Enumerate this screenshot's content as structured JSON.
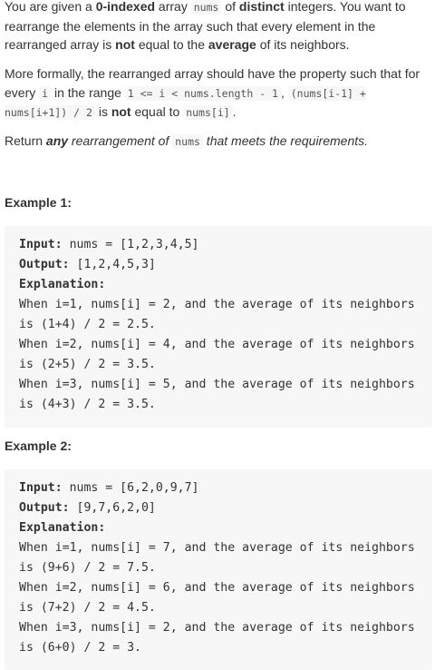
{
  "description": {
    "para1": {
      "t1": "You are given a ",
      "b1": "0-indexed",
      "t2": " array ",
      "c1": "nums",
      "t3": " of ",
      "b2": "distinct",
      "t4": " integers. You want to rearrange the elements in the array such that every element in the rearranged array is ",
      "b3": "not",
      "t5": " equal to the ",
      "b4": "average",
      "t6": " of its neighbors."
    },
    "para2": {
      "t1": "More formally, the rearranged array should have the property such that for every ",
      "c1": "i",
      "t2": " in the range ",
      "c2": "1 <= i < nums.length - 1",
      "t3": ", ",
      "c3": "(nums[i-1] + nums[i+1]) / 2",
      "t4": " is ",
      "b1": "not",
      "t5": " equal to ",
      "c4": "nums[i]",
      "t6": "."
    },
    "para3": {
      "t1": "Return ",
      "b1": "any",
      "t2": " rearrangement of ",
      "c1": "nums",
      "t3": " that meets the requirements."
    }
  },
  "examples": [
    {
      "title": "Example 1:",
      "input_label": "Input:",
      "input_value": " nums = [1,2,3,4,5]",
      "output_label": "Output:",
      "output_value": " [1,2,4,5,3]",
      "explanation_label": "Explanation:",
      "lines": [
        "When i=1, nums[i] = 2, and the average of its neighbors",
        "is (1+4) / 2 = 2.5.",
        "When i=2, nums[i] = 4, and the average of its neighbors",
        "is (2+5) / 2 = 3.5.",
        "When i=3, nums[i] = 5, and the average of its neighbors",
        "is (4+3) / 2 = 3.5."
      ]
    },
    {
      "title": "Example 2:",
      "input_label": "Input:",
      "input_value": " nums = [6,2,0,9,7]",
      "output_label": "Output:",
      "output_value": " [9,7,6,2,0]",
      "explanation_label": "Explanation:",
      "lines": [
        "When i=1, nums[i] = 7, and the average of its neighbors",
        "is (9+6) / 2 = 7.5.",
        "When i=2, nums[i] = 6, and the average of its neighbors",
        "is (7+2) / 2 = 4.5.",
        "When i=3, nums[i] = 2, and the average of its neighbors",
        "is (6+0) / 2 = 3."
      ]
    }
  ]
}
